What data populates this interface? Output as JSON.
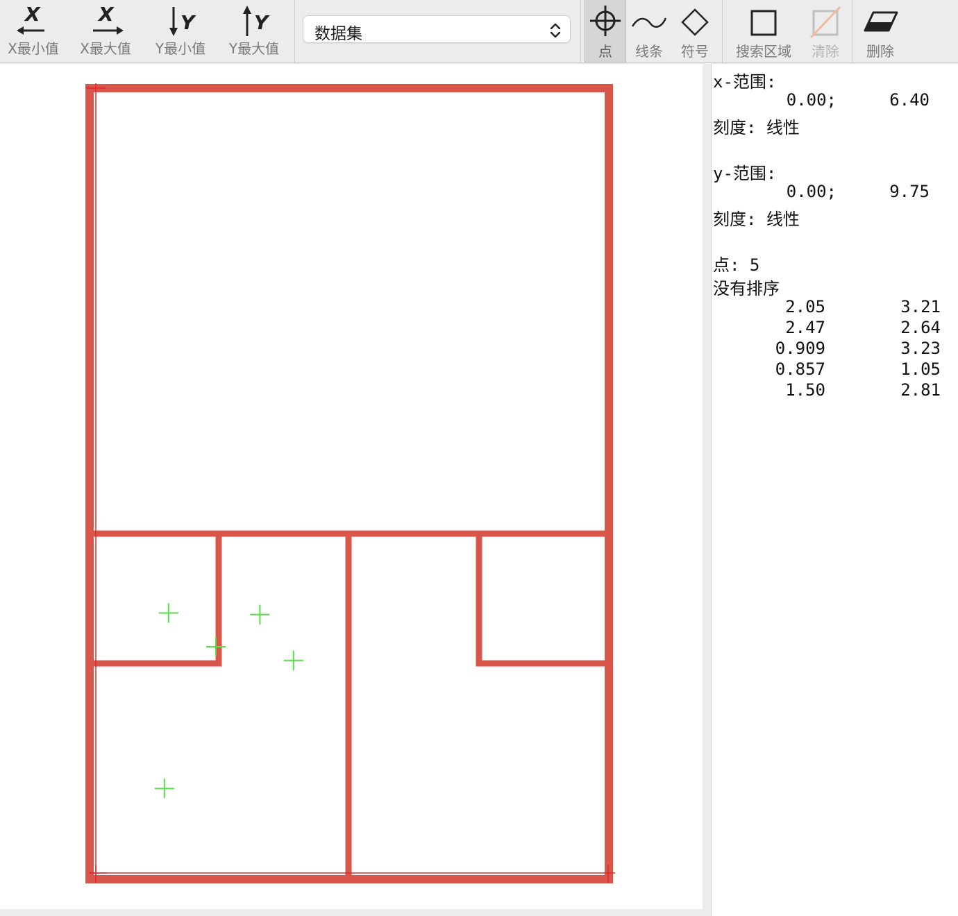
{
  "toolbar": {
    "x_min": {
      "icon": "x-min-icon",
      "label": "X最小值"
    },
    "x_max": {
      "icon": "x-max-icon",
      "label": "X最大值"
    },
    "y_min": {
      "icon": "y-min-icon",
      "label": "Y最小值"
    },
    "y_max": {
      "icon": "y-max-icon",
      "label": "Y最大值"
    },
    "dataset": {
      "selected": "数据集"
    },
    "tools": [
      {
        "name": "point",
        "label": "点",
        "icon": "crosshair-icon",
        "active": true
      },
      {
        "name": "line",
        "label": "线条",
        "icon": "curve-icon"
      },
      {
        "name": "symbol",
        "label": "符号",
        "icon": "diamond-icon"
      },
      {
        "name": "search_area",
        "label": "搜索区域",
        "icon": "square-icon"
      },
      {
        "name": "clear",
        "label": "清除",
        "icon": "clear-square-icon",
        "disabled": true
      },
      {
        "name": "delete",
        "label": "删除",
        "icon": "eraser-icon"
      }
    ]
  },
  "info": {
    "x_range_label": "x-范围:",
    "x_min": "0.00;",
    "x_max": "6.40",
    "x_scale": "刻度: 线性",
    "y_range_label": "y-范围:",
    "y_min": "0.00;",
    "y_max": "9.75",
    "y_scale": "刻度: 线性",
    "points_label": "点: 5",
    "order_label": "没有排序",
    "points": [
      {
        "x": "2.05",
        "y": "3.21"
      },
      {
        "x": "2.47",
        "y": "2.64"
      },
      {
        "x": "0.909",
        "y": "3.23"
      },
      {
        "x": "0.857",
        "y": "1.05"
      },
      {
        "x": "1.50",
        "y": "2.81"
      }
    ]
  },
  "canvas": {
    "outline_color": "#d9574a",
    "axis_marker_color": "#e8262b",
    "point_marker_color": "#53e046",
    "x_range": [
      0.0,
      6.4
    ],
    "y_range": [
      0.0,
      9.75
    ]
  }
}
